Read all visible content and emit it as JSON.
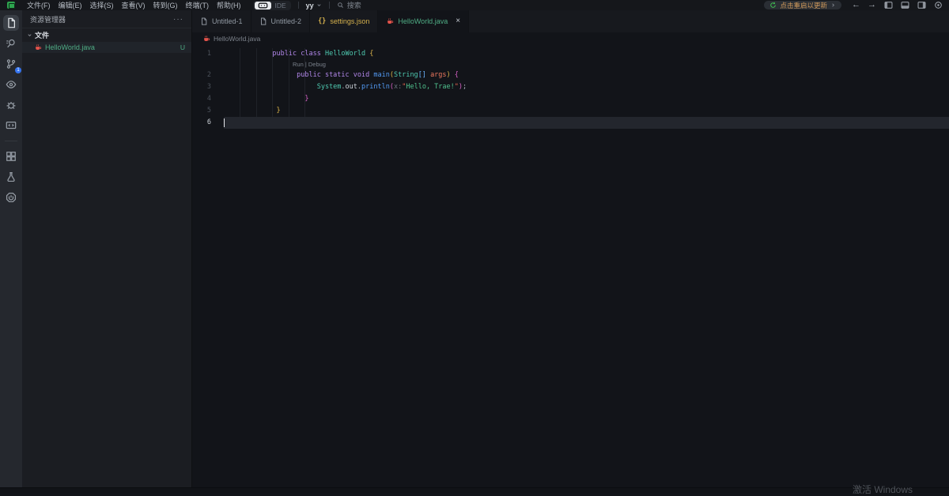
{
  "titlebar": {
    "menus": [
      "文件(F)",
      "编辑(E)",
      "选择(S)",
      "查看(V)",
      "转到(G)",
      "终端(T)",
      "帮助(H)"
    ],
    "ide_label": "IDE",
    "workspace_name": "yy",
    "search_label": "搜索",
    "update_label": "点击重启以更新"
  },
  "activity_bar": {
    "items": [
      {
        "name": "explorer",
        "active": true
      },
      {
        "name": "search"
      },
      {
        "name": "source-control",
        "badge": "1"
      },
      {
        "name": "watch"
      },
      {
        "name": "debug"
      },
      {
        "name": "remote-window"
      },
      {
        "name": "divider"
      },
      {
        "name": "extensions"
      },
      {
        "name": "testing"
      },
      {
        "name": "power"
      }
    ]
  },
  "sidebar": {
    "title": "资源管理器",
    "more_label": "···",
    "section_label": "文件",
    "files": [
      {
        "name": "HelloWorld.java",
        "git_status": "U"
      }
    ]
  },
  "editor": {
    "tabs": [
      {
        "label": "Untitled-1",
        "icon": "file",
        "color": "#9199a3",
        "active": false
      },
      {
        "label": "Untitled-2",
        "icon": "file",
        "color": "#9199a3",
        "active": false
      },
      {
        "label": "settings.json",
        "icon": "json",
        "color": "#d5b14d",
        "active": false
      },
      {
        "label": "HelloWorld.java",
        "icon": "java",
        "color": "#4fae85",
        "active": true,
        "closable": true,
        "close_glyph": "×"
      }
    ],
    "breadcrumb": {
      "label": "HelloWorld.java"
    },
    "rows": [
      {
        "type": "code",
        "num": "1",
        "indent": 12,
        "tokens": [
          [
            "kw",
            "public class "
          ],
          [
            "cls",
            "HelloWorld"
          ],
          [
            "txt",
            " "
          ],
          [
            "b1",
            "{"
          ]
        ]
      },
      {
        "type": "lens",
        "text": "Run | Debug"
      },
      {
        "type": "code",
        "num": "2",
        "indent": 18,
        "tokens": [
          [
            "kw",
            "public static void "
          ],
          [
            "fn",
            "main"
          ],
          [
            "b1",
            "("
          ],
          [
            "cls",
            "String"
          ],
          [
            "b3",
            "[]"
          ],
          [
            "txt",
            " "
          ],
          [
            "var",
            "args"
          ],
          [
            "b1",
            ")"
          ],
          [
            "txt",
            " "
          ],
          [
            "b2",
            "{"
          ]
        ]
      },
      {
        "type": "code",
        "num": "3",
        "indent": 23,
        "tokens": [
          [
            "cls",
            "System"
          ],
          [
            "pun",
            "."
          ],
          [
            "txt",
            "out"
          ],
          [
            "pun",
            "."
          ],
          [
            "fn",
            "println"
          ],
          [
            "b2",
            "("
          ],
          [
            "hint",
            "x:"
          ],
          [
            "strq",
            "\""
          ],
          [
            "str",
            "Hello, Trae!"
          ],
          [
            "strq",
            "\""
          ],
          [
            "b2",
            ")"
          ],
          [
            "pun",
            ";"
          ]
        ]
      },
      {
        "type": "code",
        "num": "4",
        "indent": 20,
        "tokens": [
          [
            "b2",
            "}"
          ]
        ]
      },
      {
        "type": "code",
        "num": "5",
        "indent": 13,
        "tokens": [
          [
            "b1",
            "}"
          ]
        ]
      },
      {
        "type": "code",
        "num": "6",
        "indent": 0,
        "tokens": [],
        "current": true,
        "cursor": true
      }
    ]
  },
  "watermark": "激活 Windows",
  "colors": {
    "token_kw": "#b287ea",
    "token_cls": "#4ec9b0",
    "token_fn": "#539bf5",
    "token_var": "#ee795f",
    "token_str": "#4fc08d",
    "token_strq": "#e5654f",
    "token_b1": "#ddb54a",
    "token_b2": "#d862c8",
    "token_b3": "#6cb6ff",
    "token_pun": "#a9b1bb",
    "token_txt": "#ced4db",
    "token_hint": "#6b727c",
    "update_text": "#d19a5b",
    "update_icon": "#3fb950",
    "git_green": "#4fae85",
    "json_yellow": "#d5b14d",
    "java_red": "#e5534b"
  }
}
